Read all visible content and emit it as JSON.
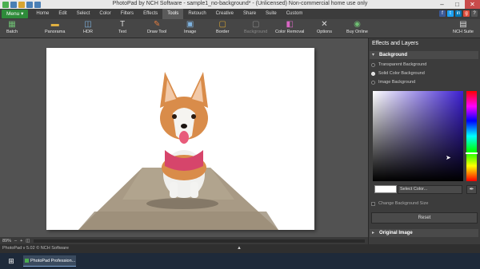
{
  "window": {
    "title": "PhotoPad by NCH Software - sample1_no-background* - (Unlicensed) Non-commercial home use only",
    "minimize": "–",
    "maximize": "□",
    "close": "✕"
  },
  "menubar": {
    "menu_label": "Menu ▾",
    "tabs": [
      {
        "label": "Home"
      },
      {
        "label": "Edit"
      },
      {
        "label": "Select"
      },
      {
        "label": "Color"
      },
      {
        "label": "Filters"
      },
      {
        "label": "Effects"
      },
      {
        "label": "Tools"
      },
      {
        "label": "Retouch"
      },
      {
        "label": "Creative"
      },
      {
        "label": "Share"
      },
      {
        "label": "Suite"
      },
      {
        "label": "Custom"
      }
    ],
    "active_tab": "Tools"
  },
  "toolbar": {
    "items": [
      {
        "label": "Batch",
        "icon": "batch-icon"
      },
      {
        "label": "Panorama",
        "icon": "panorama-icon"
      },
      {
        "label": "HDR",
        "icon": "hdr-icon"
      },
      {
        "label": "Text",
        "icon": "text-icon"
      },
      {
        "label": "Draw Tool",
        "icon": "draw-tool-icon"
      },
      {
        "label": "Image",
        "icon": "image-icon"
      },
      {
        "label": "Border",
        "icon": "border-icon"
      },
      {
        "label": "Background",
        "icon": "background-icon"
      },
      {
        "label": "Color Removal",
        "icon": "color-removal-icon"
      },
      {
        "label": "Options",
        "icon": "options-icon"
      },
      {
        "label": "Buy Online",
        "icon": "buy-online-icon"
      },
      {
        "label": "NCH Suite",
        "icon": "nch-suite-icon"
      }
    ]
  },
  "zoom": {
    "level": "89%"
  },
  "panel": {
    "title": "Effects and Layers",
    "background_section": {
      "title": "Background",
      "options": [
        {
          "label": "Transparent Background",
          "selected": false
        },
        {
          "label": "Solid Color Background",
          "selected": true
        },
        {
          "label": "Image Background",
          "selected": false
        }
      ],
      "select_color_label": "Select Color...",
      "change_size_label": "Change Background Size",
      "reset_label": "Reset"
    },
    "original_image_section": {
      "title": "Original Image"
    }
  },
  "statusbar": {
    "text": "PhotoPad v 5.02 © NCH Software"
  },
  "taskbar": {
    "item_label": "PhotoPad Profession..."
  },
  "colors": {
    "accent_green": "#2e8b3a",
    "panel_bg": "#3c3c3c",
    "picker_hue": "#3c1fd1"
  }
}
